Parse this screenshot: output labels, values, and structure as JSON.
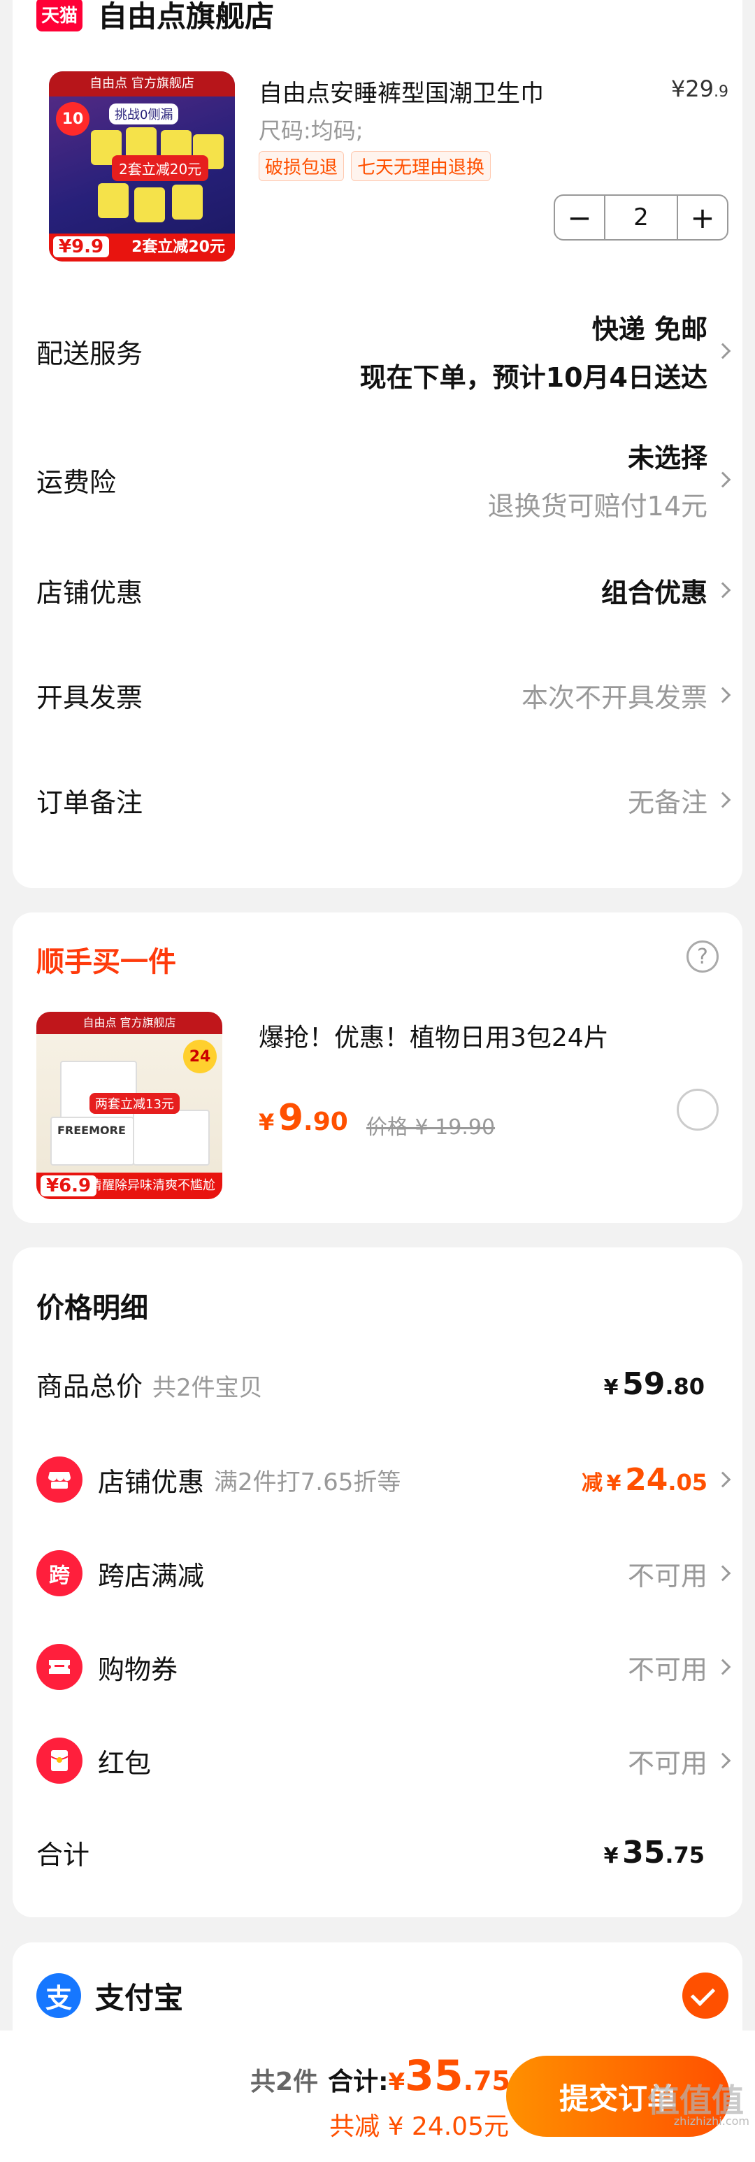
{
  "store": {
    "badge": "天猫",
    "name": "自由点旗舰店"
  },
  "product": {
    "title": "自由点安睡裤型国潮卫生巾",
    "price_int": "¥29",
    "price_dec": ".9",
    "sku": "尺码:均码;",
    "tags": [
      "破损包退",
      "七天无理由退换"
    ],
    "quantity": "2",
    "thumb": {
      "store_strip": "自由点 官方旗舰店",
      "badge_num": "10",
      "challenge": "挑战0侧漏",
      "promo": "2套立减20元",
      "bottom": "2套立减20元",
      "price": "¥9.9"
    }
  },
  "rows": {
    "delivery": {
      "label": "配送服务",
      "line1": "快递 免邮",
      "line2": "现在下单，预计10月4日送达"
    },
    "insurance": {
      "label": "运费险",
      "line1": "未选择",
      "line2": "退换货可赔付14元"
    },
    "store_discount": {
      "label": "店铺优惠",
      "value": "组合优惠"
    },
    "invoice": {
      "label": "开具发票",
      "value": "本次不开具发票"
    },
    "remark": {
      "label": "订单备注",
      "value": "无备注"
    }
  },
  "recommend": {
    "title": "顺手买一件",
    "item_name": "爆抢！优惠！植物日用3包24片",
    "price_cur": "¥",
    "price_int": "9",
    "price_dec": ".90",
    "orig_price": "价格 ¥ 19.90",
    "thumb": {
      "store_strip": "自由点 官方旗舰店",
      "badge": "24",
      "brand": "FREEMORE",
      "promo": "两套立减13元",
      "bottom": "清醒除异味清爽不尴尬",
      "price": "¥6.9"
    }
  },
  "price_detail": {
    "title": "价格明细",
    "total": {
      "label": "商品总价",
      "sub": "共2件宝贝",
      "cur": "¥",
      "int": "59",
      "dec": ".80"
    },
    "store_discount": {
      "icon": "store-icon",
      "label": "店铺优惠",
      "sub": "满2件打7.65折等",
      "prefix": "减",
      "cur": "¥",
      "int": "24",
      "dec": ".05"
    },
    "cross_store": {
      "icon_text": "跨",
      "label": "跨店满减",
      "value": "不可用"
    },
    "coupon": {
      "icon": "ticket-icon",
      "label": "购物券",
      "value": "不可用"
    },
    "red_packet": {
      "icon": "red-packet-icon",
      "label": "红包",
      "value": "不可用"
    },
    "sum": {
      "label": "合计",
      "cur": "¥",
      "int": "35",
      "dec": ".75"
    }
  },
  "payment": {
    "icon_text": "支",
    "name": "支付宝"
  },
  "bottom_bar": {
    "count": "共2件",
    "label": "合计:",
    "cur": "¥",
    "int": "35",
    "dec": ".75",
    "discount": "共减 ¥ 24.05元",
    "submit": "提交订单",
    "watermark": "zhizhizhi.com",
    "watermark_big": "值值值"
  },
  "colors": {
    "accent": "#ff5000",
    "tmall_red": "#ff0036",
    "alipay_blue": "#1677ff"
  }
}
